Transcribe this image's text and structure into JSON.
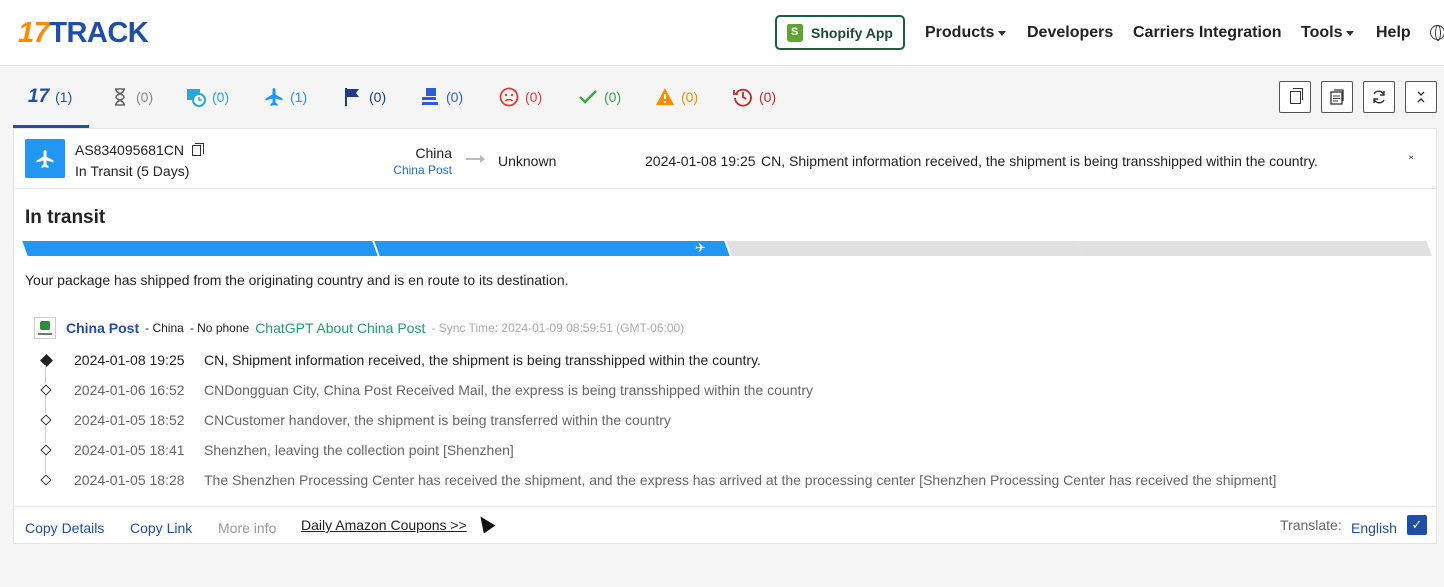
{
  "header": {
    "logo_num": "17",
    "logo_word": "TRACK",
    "shopify_label": "Shopify App",
    "nav": {
      "products": "Products",
      "developers": "Developers",
      "carriers": "Carriers Integration",
      "tools": "Tools",
      "help": "Help"
    }
  },
  "tabs": [
    {
      "name": "all",
      "count": "(1)",
      "color": "#1f4ea8"
    },
    {
      "name": "not-found",
      "count": "(0)",
      "color": "#888888"
    },
    {
      "name": "info-received",
      "count": "(0)",
      "color": "#29a8d8"
    },
    {
      "name": "in-transit",
      "count": "(1)",
      "color": "#2196f3"
    },
    {
      "name": "pick-up",
      "count": "(0)",
      "color": "#1f3c88"
    },
    {
      "name": "out-for-delivery",
      "count": "(0)",
      "color": "#2e5bd6"
    },
    {
      "name": "undelivered",
      "count": "(0)",
      "color": "#e53935"
    },
    {
      "name": "delivered",
      "count": "(0)",
      "color": "#43a047"
    },
    {
      "name": "alert",
      "count": "(0)",
      "color": "#fb8c00"
    },
    {
      "name": "expired",
      "count": "(0)",
      "color": "#c62828"
    }
  ],
  "shipment": {
    "tracking_number": "AS834095681CN",
    "status_days": "In Transit (5 Days)",
    "origin": "China",
    "origin_carrier": "China Post",
    "destination": "Unknown",
    "last_time": "2024-01-08 19:25",
    "last_desc": "CN, Shipment information received, the shipment is being transshipped within the country."
  },
  "detail": {
    "title": "In transit",
    "progress_stage": 2,
    "message": "Your package has shipped from the originating country and is en route to its destination."
  },
  "carrier": {
    "name": "China Post",
    "country": "- China",
    "phone": "- No phone",
    "gpt_link": "ChatGPT About China Post",
    "sync": "- Sync Time: 2024-01-09 08:59:51 (GMT-06:00)"
  },
  "events": [
    {
      "time": "2024-01-08 19:25",
      "desc": "CN, Shipment information received, the shipment is being transshipped within the country."
    },
    {
      "time": "2024-01-06 16:52",
      "desc": "CNDongguan City, China Post Received Mail, the express is being transshipped within the country"
    },
    {
      "time": "2024-01-05 18:52",
      "desc": "CNCustomer handover, the shipment is being transferred within the country"
    },
    {
      "time": "2024-01-05 18:41",
      "desc": "Shenzhen, leaving the collection point [Shenzhen]"
    },
    {
      "time": "2024-01-05 18:28",
      "desc": "The Shenzhen Processing Center has received the shipment, and the express has arrived at the processing center [Shenzhen Processing Center has received the shipment]"
    }
  ],
  "footer": {
    "copy_details": "Copy Details",
    "copy_link": "Copy Link",
    "more_info": "More info",
    "ad": "Daily Amazon Coupons >>",
    "translate_label": "Translate:",
    "translate_lang": "English"
  }
}
